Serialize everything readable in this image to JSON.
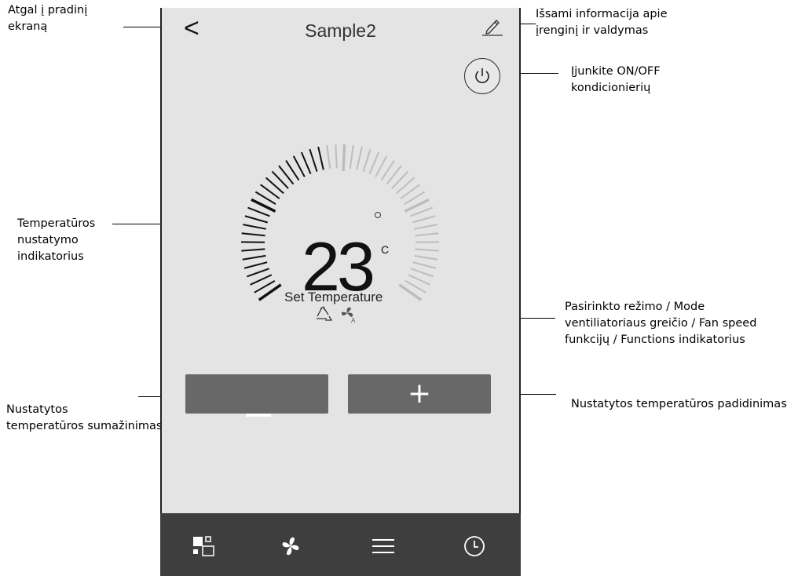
{
  "app": {
    "title": "Sample2",
    "back_glyph": "<",
    "plus_glyph": "+",
    "temperature": "23",
    "unit": "C",
    "set_label": "Set Temperature",
    "icons": {
      "back": "back-arrow-icon",
      "edit": "pencil-icon",
      "power": "power-icon",
      "mode": "recycle-mode-icon",
      "fan": "fan-auto-icon"
    },
    "tabbar": [
      {
        "icon": "mode-grid-icon"
      },
      {
        "icon": "fan-icon"
      },
      {
        "icon": "menu-icon"
      },
      {
        "icon": "clock-icon"
      }
    ],
    "colors": {
      "screen_bg": "#e4e4e4",
      "button_bg": "#686868",
      "tabbar_bg": "#3e3e3e",
      "dial_active": "#111111",
      "dial_inactive": "#bdbdbd"
    },
    "dial": {
      "min": 16,
      "max": 31,
      "value": 23
    }
  },
  "annotations": {
    "back_l1": "Atgal į pradinį",
    "back_l2": "ekraną",
    "details_l1": "Išsami informacija apie",
    "details_l2": "įrenginį ir valdymas",
    "power_l1": "Įjunkite ON/OFF",
    "power_l2": "kondicionierių",
    "indicator_l1": "Temperatūros",
    "indicator_l2": "nustatymo",
    "indicator_l3": "indikatorius",
    "mode_l1": "Pasirinkto režimo / Mode",
    "mode_l2": "ventiliatoriaus greičio / Fan speed",
    "mode_l3": "funkcijų / Functions indikatorius",
    "decrease_l1": "Nustatytos",
    "decrease_l2": "temperatūros sumažinimas",
    "increase_l1": "Nustatytos temperatūros padidinimas"
  }
}
